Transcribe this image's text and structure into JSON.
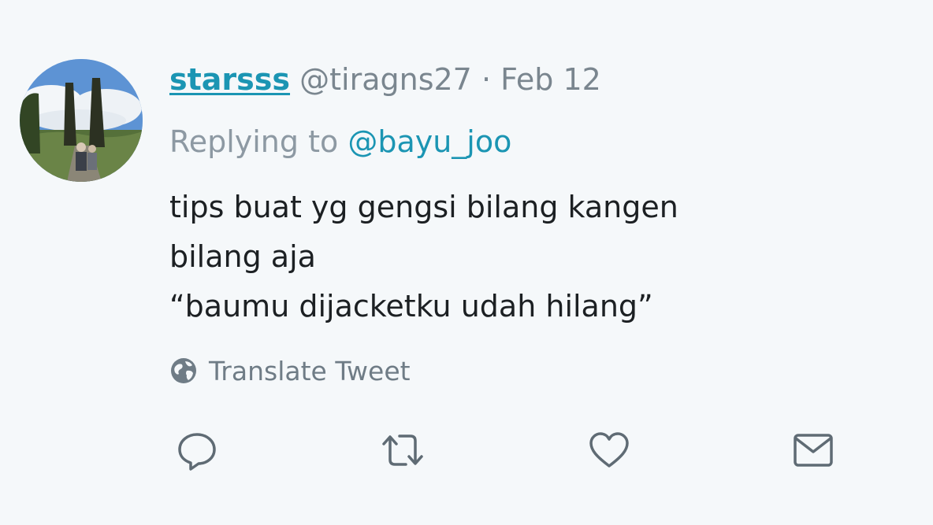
{
  "tweet": {
    "display_name": "starsss",
    "handle": "@tiragns27",
    "separator": "·",
    "date": "Feb 12",
    "replying_label": "Replying to",
    "reply_to": "@bayu_joo",
    "text_lines": [
      "tips buat yg gengsi bilang kangen",
      "bilang aja",
      "“baumu dijacketku udah hilang”"
    ],
    "translate_label": "Translate Tweet"
  },
  "actions": [
    {
      "name": "reply",
      "icon": "reply-icon"
    },
    {
      "name": "retweet",
      "icon": "retweet-icon"
    },
    {
      "name": "like",
      "icon": "heart-icon"
    },
    {
      "name": "message",
      "icon": "envelope-icon"
    }
  ],
  "colors": {
    "background": "#f5f8fa",
    "link": "#1b95b3",
    "muted": "#7a868f",
    "icon": "#5f6b74"
  }
}
